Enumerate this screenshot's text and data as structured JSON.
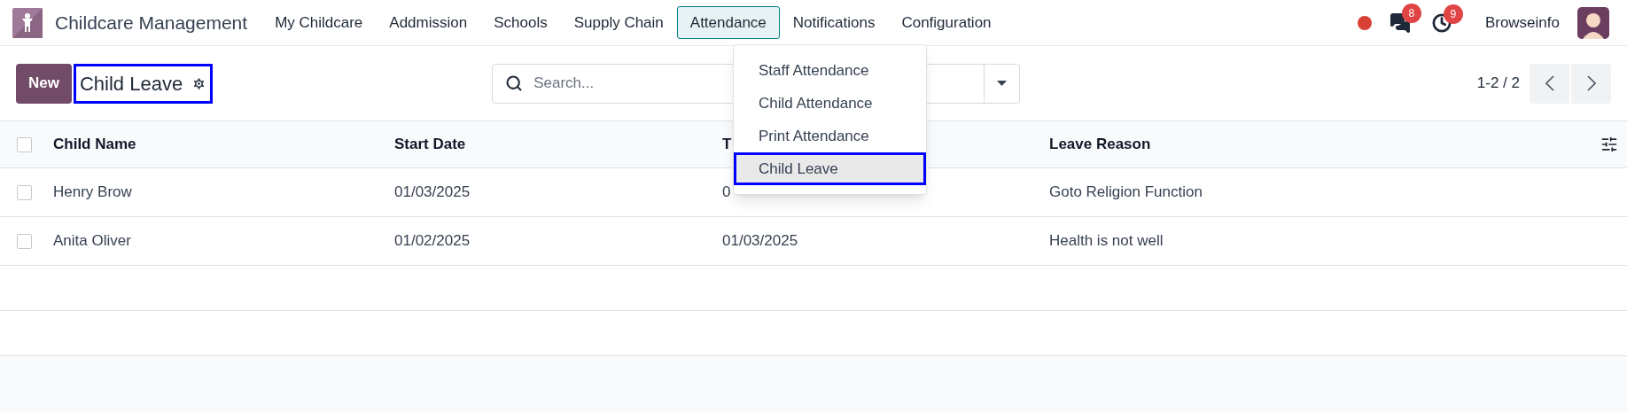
{
  "navbar": {
    "app_name": "Childcare Management",
    "menus": [
      {
        "label": "My Childcare",
        "selected": false
      },
      {
        "label": "Addmission",
        "selected": false
      },
      {
        "label": "Schools",
        "selected": false
      },
      {
        "label": "Supply Chain",
        "selected": false
      },
      {
        "label": "Attendance",
        "selected": true
      },
      {
        "label": "Notifications",
        "selected": false
      },
      {
        "label": "Configuration",
        "selected": false
      }
    ],
    "messages_badge": "8",
    "activities_badge": "9",
    "user_name": "Browseinfo"
  },
  "attendance_menu": {
    "items": [
      {
        "label": "Staff Attendance",
        "selected": false,
        "highlighted": false
      },
      {
        "label": "Child Attendance",
        "selected": false,
        "highlighted": false
      },
      {
        "label": "Print Attendance",
        "selected": false,
        "highlighted": false
      },
      {
        "label": "Child Leave",
        "selected": true,
        "highlighted": true
      }
    ]
  },
  "control_panel": {
    "new_button": "New",
    "breadcrumb": {
      "label": "Child Leave",
      "highlighted": true
    },
    "search": {
      "placeholder": "Search..."
    },
    "pager": "1-2 / 2"
  },
  "table": {
    "select_all_checked": false,
    "columns": [
      "Child Name",
      "Start Date",
      "T",
      "Leave Reason"
    ],
    "rows": [
      {
        "checked": false,
        "cells": [
          "Henry Brow",
          "01/03/2025",
          "0",
          "Goto Religion Function"
        ]
      },
      {
        "checked": false,
        "cells": [
          "Anita Oliver",
          "01/02/2025",
          "01/03/2025",
          "Health is not well"
        ]
      }
    ]
  }
}
